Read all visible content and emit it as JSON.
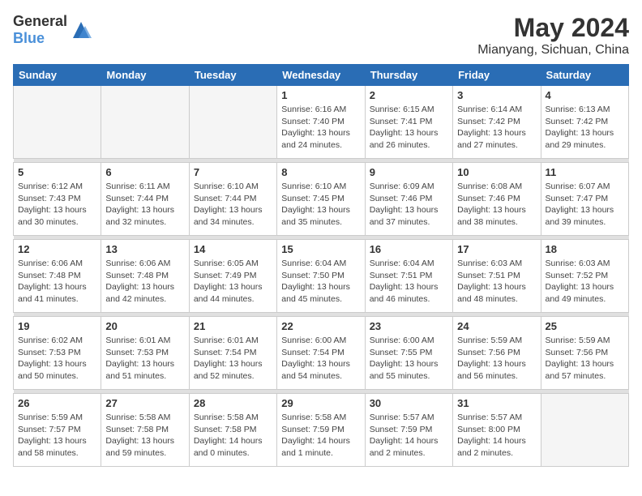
{
  "header": {
    "logo_general": "General",
    "logo_blue": "Blue",
    "month_year": "May 2024",
    "location": "Mianyang, Sichuan, China"
  },
  "days_of_week": [
    "Sunday",
    "Monday",
    "Tuesday",
    "Wednesday",
    "Thursday",
    "Friday",
    "Saturday"
  ],
  "weeks": [
    [
      {
        "day": "",
        "info": ""
      },
      {
        "day": "",
        "info": ""
      },
      {
        "day": "",
        "info": ""
      },
      {
        "day": "1",
        "info": "Sunrise: 6:16 AM\nSunset: 7:40 PM\nDaylight: 13 hours\nand 24 minutes."
      },
      {
        "day": "2",
        "info": "Sunrise: 6:15 AM\nSunset: 7:41 PM\nDaylight: 13 hours\nand 26 minutes."
      },
      {
        "day": "3",
        "info": "Sunrise: 6:14 AM\nSunset: 7:42 PM\nDaylight: 13 hours\nand 27 minutes."
      },
      {
        "day": "4",
        "info": "Sunrise: 6:13 AM\nSunset: 7:42 PM\nDaylight: 13 hours\nand 29 minutes."
      }
    ],
    [
      {
        "day": "5",
        "info": "Sunrise: 6:12 AM\nSunset: 7:43 PM\nDaylight: 13 hours\nand 30 minutes."
      },
      {
        "day": "6",
        "info": "Sunrise: 6:11 AM\nSunset: 7:44 PM\nDaylight: 13 hours\nand 32 minutes."
      },
      {
        "day": "7",
        "info": "Sunrise: 6:10 AM\nSunset: 7:44 PM\nDaylight: 13 hours\nand 34 minutes."
      },
      {
        "day": "8",
        "info": "Sunrise: 6:10 AM\nSunset: 7:45 PM\nDaylight: 13 hours\nand 35 minutes."
      },
      {
        "day": "9",
        "info": "Sunrise: 6:09 AM\nSunset: 7:46 PM\nDaylight: 13 hours\nand 37 minutes."
      },
      {
        "day": "10",
        "info": "Sunrise: 6:08 AM\nSunset: 7:46 PM\nDaylight: 13 hours\nand 38 minutes."
      },
      {
        "day": "11",
        "info": "Sunrise: 6:07 AM\nSunset: 7:47 PM\nDaylight: 13 hours\nand 39 minutes."
      }
    ],
    [
      {
        "day": "12",
        "info": "Sunrise: 6:06 AM\nSunset: 7:48 PM\nDaylight: 13 hours\nand 41 minutes."
      },
      {
        "day": "13",
        "info": "Sunrise: 6:06 AM\nSunset: 7:48 PM\nDaylight: 13 hours\nand 42 minutes."
      },
      {
        "day": "14",
        "info": "Sunrise: 6:05 AM\nSunset: 7:49 PM\nDaylight: 13 hours\nand 44 minutes."
      },
      {
        "day": "15",
        "info": "Sunrise: 6:04 AM\nSunset: 7:50 PM\nDaylight: 13 hours\nand 45 minutes."
      },
      {
        "day": "16",
        "info": "Sunrise: 6:04 AM\nSunset: 7:51 PM\nDaylight: 13 hours\nand 46 minutes."
      },
      {
        "day": "17",
        "info": "Sunrise: 6:03 AM\nSunset: 7:51 PM\nDaylight: 13 hours\nand 48 minutes."
      },
      {
        "day": "18",
        "info": "Sunrise: 6:03 AM\nSunset: 7:52 PM\nDaylight: 13 hours\nand 49 minutes."
      }
    ],
    [
      {
        "day": "19",
        "info": "Sunrise: 6:02 AM\nSunset: 7:53 PM\nDaylight: 13 hours\nand 50 minutes."
      },
      {
        "day": "20",
        "info": "Sunrise: 6:01 AM\nSunset: 7:53 PM\nDaylight: 13 hours\nand 51 minutes."
      },
      {
        "day": "21",
        "info": "Sunrise: 6:01 AM\nSunset: 7:54 PM\nDaylight: 13 hours\nand 52 minutes."
      },
      {
        "day": "22",
        "info": "Sunrise: 6:00 AM\nSunset: 7:54 PM\nDaylight: 13 hours\nand 54 minutes."
      },
      {
        "day": "23",
        "info": "Sunrise: 6:00 AM\nSunset: 7:55 PM\nDaylight: 13 hours\nand 55 minutes."
      },
      {
        "day": "24",
        "info": "Sunrise: 5:59 AM\nSunset: 7:56 PM\nDaylight: 13 hours\nand 56 minutes."
      },
      {
        "day": "25",
        "info": "Sunrise: 5:59 AM\nSunset: 7:56 PM\nDaylight: 13 hours\nand 57 minutes."
      }
    ],
    [
      {
        "day": "26",
        "info": "Sunrise: 5:59 AM\nSunset: 7:57 PM\nDaylight: 13 hours\nand 58 minutes."
      },
      {
        "day": "27",
        "info": "Sunrise: 5:58 AM\nSunset: 7:58 PM\nDaylight: 13 hours\nand 59 minutes."
      },
      {
        "day": "28",
        "info": "Sunrise: 5:58 AM\nSunset: 7:58 PM\nDaylight: 14 hours\nand 0 minutes."
      },
      {
        "day": "29",
        "info": "Sunrise: 5:58 AM\nSunset: 7:59 PM\nDaylight: 14 hours\nand 1 minute."
      },
      {
        "day": "30",
        "info": "Sunrise: 5:57 AM\nSunset: 7:59 PM\nDaylight: 14 hours\nand 2 minutes."
      },
      {
        "day": "31",
        "info": "Sunrise: 5:57 AM\nSunset: 8:00 PM\nDaylight: 14 hours\nand 2 minutes."
      },
      {
        "day": "",
        "info": ""
      }
    ]
  ]
}
